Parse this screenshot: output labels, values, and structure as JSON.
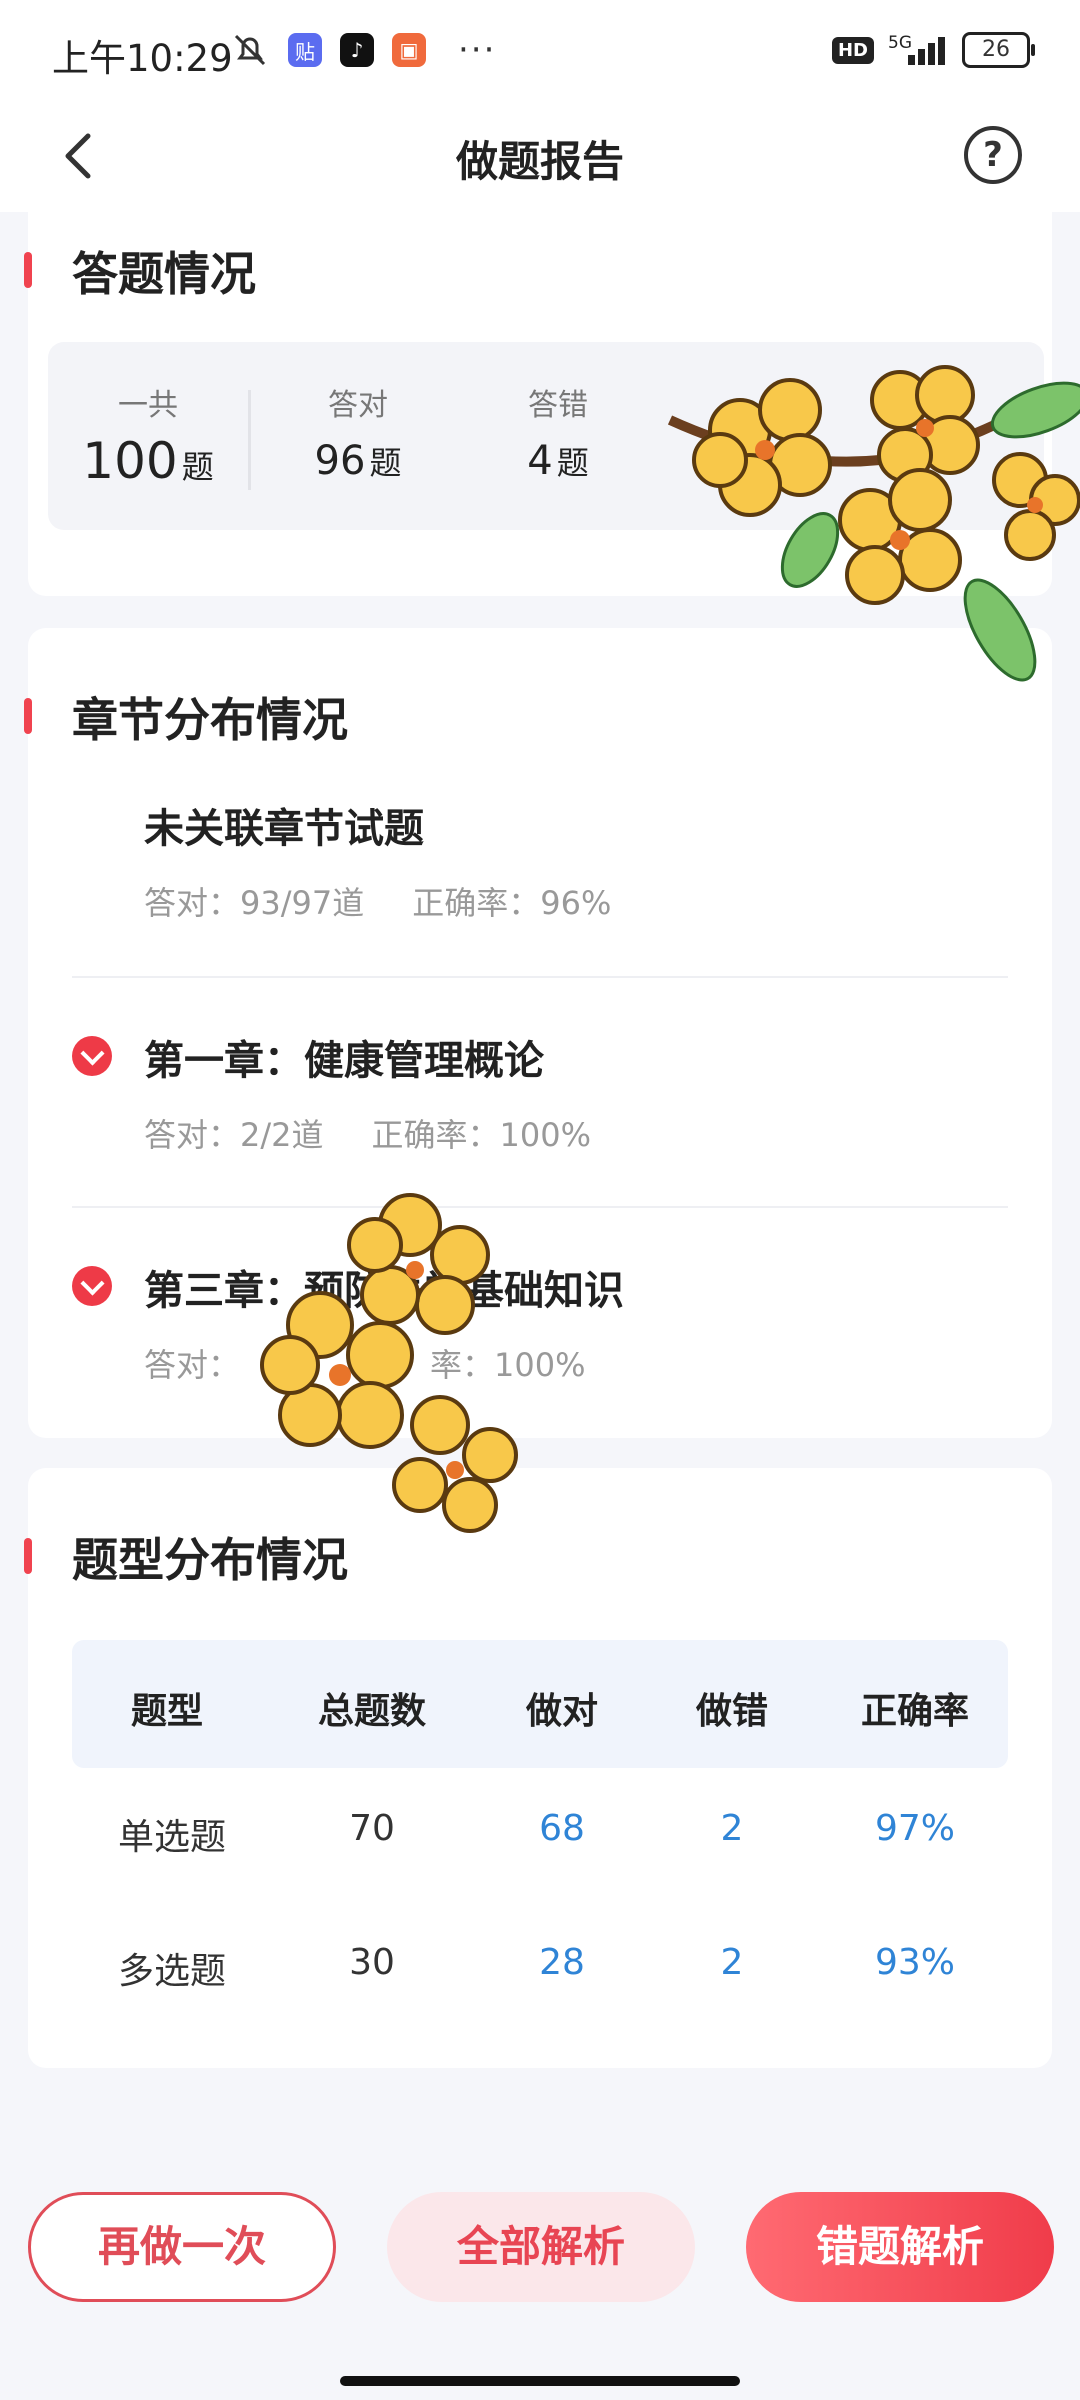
{
  "status_bar": {
    "time": "上午10:29",
    "battery": "26",
    "network": "5G",
    "hd": "HD",
    "more": "···"
  },
  "nav": {
    "title": "做题报告",
    "help": "?"
  },
  "summary": {
    "title": "答题情况",
    "total_label": "一共",
    "total_value": "100",
    "total_unit": "题",
    "correct_label": "答对",
    "correct_value": "96",
    "correct_unit": "题",
    "wrong_label": "答错",
    "wrong_value": "4",
    "wrong_unit": "题"
  },
  "chapters": {
    "title": "章节分布情况",
    "items": [
      {
        "name": "未关联章节试题",
        "correct": "答对：93/97道",
        "rate": "正确率：96%"
      },
      {
        "name": "第一章：健康管理概论",
        "correct": "答对：2/2道",
        "rate": "正确率：100%"
      },
      {
        "name": "第三章：预防医学基础知识",
        "correct": "答对：",
        "rate": "率：100%"
      }
    ]
  },
  "types": {
    "title": "题型分布情况",
    "headers": [
      "题型",
      "总题数",
      "做对",
      "做错",
      "正确率"
    ],
    "rows": [
      [
        "单选题",
        "70",
        "68",
        "2",
        "97%"
      ],
      [
        "多选题",
        "30",
        "28",
        "2",
        "93%"
      ]
    ]
  },
  "buttons": {
    "redo": "再做一次",
    "all": "全部解析",
    "wrong": "错题解析"
  },
  "colors": {
    "accent": "#f0434f",
    "blue_value": "#2f84d6",
    "primary_button": "#f03c4a"
  }
}
